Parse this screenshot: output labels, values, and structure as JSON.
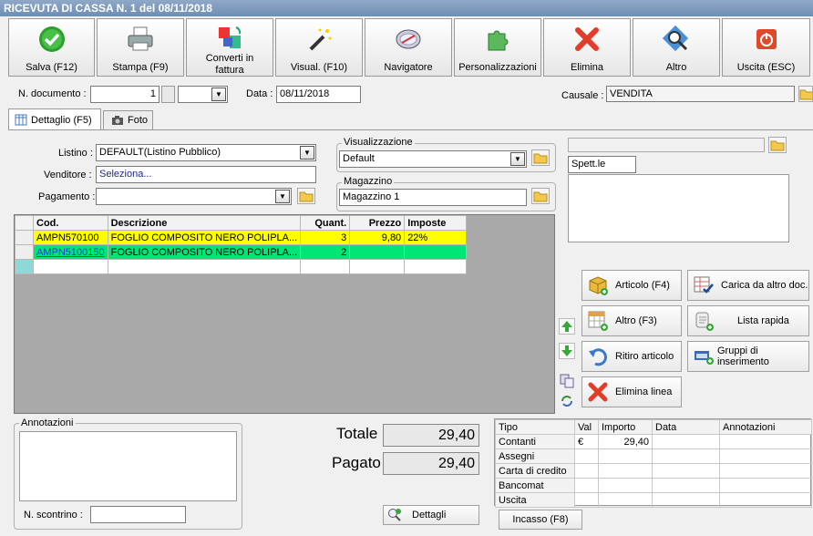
{
  "window": {
    "title": "RICEVUTA DI CASSA N. 1 del 08/11/2018"
  },
  "toolbar": {
    "salva": "Salva (F12)",
    "stampa": "Stampa (F9)",
    "converti_1": "Converti in",
    "converti_2": "fattura",
    "visual": "Visual. (F10)",
    "navigatore": "Navigatore",
    "personalizzazioni": "Personalizzazioni",
    "elimina": "Elimina",
    "altro": "Altro",
    "uscita": "Uscita (ESC)"
  },
  "header": {
    "ndoc_label": "N. documento :",
    "ndoc_value": "1",
    "data_label": "Data :",
    "data_value": "08/11/2018",
    "causale_label": "Causale :",
    "causale_value": "VENDITA"
  },
  "tabs": {
    "dettaglio": "Dettaglio (F5)",
    "foto": "Foto"
  },
  "form": {
    "listino_label": "Listino :",
    "listino_value": "DEFAULT(Listino Pubblico)",
    "venditore_label": "Venditore :",
    "venditore_value": "Seleziona...",
    "pagamento_label": "Pagamento :",
    "pagamento_value": "",
    "visualizzazione_title": "Visualizzazione",
    "visualizzazione_value": "Default",
    "magazzino_title": "Magazzino",
    "magazzino_value": "Magazzino 1",
    "cliente_value": "",
    "intestazione_value": "Spett.le"
  },
  "grid": {
    "headers": {
      "cod": "Cod.",
      "descrizione": "Descrizione",
      "quant": "Quant.",
      "prezzo": "Prezzo",
      "imposte": "Imposte"
    },
    "rows": [
      {
        "cod": "AMPN570100",
        "descrizione": "FOGLIO COMPOSITO NERO POLIPLA...",
        "quant": "3",
        "prezzo": "9,80",
        "imposte": "22%"
      },
      {
        "cod": "AMPN5100150",
        "descrizione": "FOGLIO COMPOSITO NERO POLIPLA...",
        "quant": "2",
        "prezzo": "",
        "imposte": ""
      }
    ]
  },
  "actions": {
    "articolo": "Articolo (F4)",
    "carica": "Carica da altro doc.",
    "altro": "Altro (F3)",
    "lista": "Lista rapida",
    "ritiro": "Ritiro articolo",
    "gruppi": "Gruppi di inserimento",
    "elimina_linea": "Elimina linea"
  },
  "footer": {
    "annotazioni_title": "Annotazioni",
    "scontrino_label": "N. scontrino :",
    "scontrino_value": "",
    "totale_label": "Totale",
    "totale_value": "29,40",
    "pagato_label": "Pagato",
    "pagato_value": "29,40",
    "dettagli": "Dettagli",
    "incasso": "Incasso (F8)"
  },
  "payments": {
    "headers": {
      "tipo": "Tipo",
      "val": "Val",
      "importo": "Importo",
      "data": "Data",
      "annotazioni": "Annotazioni"
    },
    "rows": [
      {
        "tipo": "Contanti",
        "val": "€",
        "importo": "29,40"
      },
      {
        "tipo": "Assegni",
        "val": "",
        "importo": ""
      },
      {
        "tipo": "Carta di credito",
        "val": "",
        "importo": ""
      },
      {
        "tipo": "Bancomat",
        "val": "",
        "importo": ""
      },
      {
        "tipo": "Uscita",
        "val": "",
        "importo": ""
      }
    ]
  },
  "colors": {
    "row_selected": "#ffff00",
    "row_highlight": "#00e676",
    "grid_bg": "#a9a9a9",
    "title_bar": "#7892b8"
  }
}
